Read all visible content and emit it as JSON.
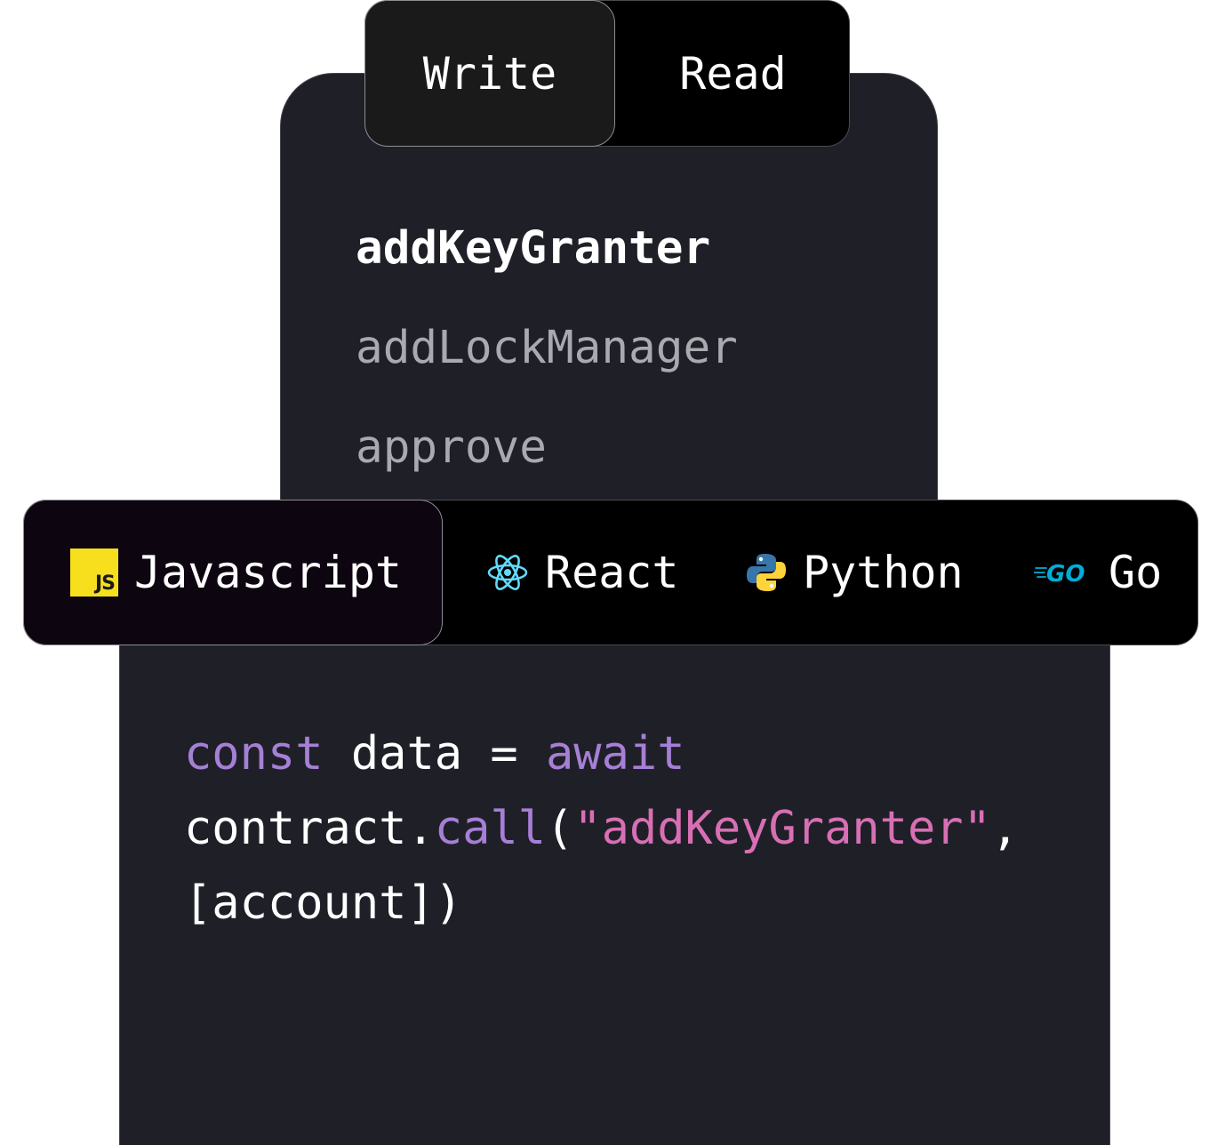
{
  "mode_tabs": {
    "write": "Write",
    "read": "Read"
  },
  "methods": [
    {
      "label": "addKeyGranter",
      "active": true
    },
    {
      "label": "addLockManager",
      "active": false
    },
    {
      "label": "approve",
      "active": false
    }
  ],
  "languages": [
    {
      "label": "Javascript",
      "icon": "javascript-icon",
      "icon_text": "JS",
      "active": true
    },
    {
      "label": "React",
      "icon": "react-icon",
      "active": false
    },
    {
      "label": "Python",
      "icon": "python-icon",
      "active": false
    },
    {
      "label": "Go",
      "icon": "go-icon",
      "icon_text": "GO",
      "active": false
    }
  ],
  "code": {
    "line1": {
      "kw1": "const",
      "t1": " data = ",
      "kw2": "await"
    },
    "line2": {
      "t1": "contract.",
      "fn": "call",
      "t2": "(",
      "str": "\"addKeyGranter\"",
      "t3": ","
    },
    "line3": {
      "t1": "[account])"
    }
  },
  "colors": {
    "panel": "#1f2027",
    "keyword": "#a67fd6",
    "string": "#d86fb4",
    "js_yellow": "#f7df1e",
    "react_cyan": "#61dafb",
    "go_cyan": "#00add8"
  }
}
